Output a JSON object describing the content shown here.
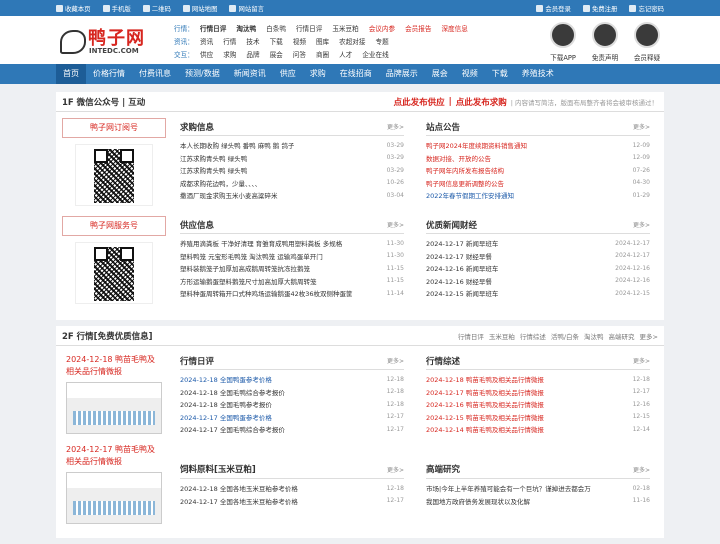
{
  "topbar": {
    "left": [
      "收藏本页",
      "手机版",
      "二维码",
      "网站地图",
      "网站留言"
    ],
    "right": [
      "会员登录",
      "免费注册",
      "忘记密码"
    ]
  },
  "logo": {
    "cn": "鸭子网",
    "en": "INTEDC.COM"
  },
  "hnav": [
    {
      "label": "行情：",
      "items": [
        {
          "t": "行情日评",
          "s": "bold"
        },
        {
          "t": "淘汰鸭",
          "s": "bold"
        },
        {
          "t": "白条鸭",
          "s": ""
        },
        {
          "t": "行情日评",
          "s": ""
        },
        {
          "t": "玉米豆粕",
          "s": ""
        },
        {
          "t": "会议内参",
          "s": "red"
        },
        {
          "t": "会员报告",
          "s": "red"
        },
        {
          "t": "深度信息",
          "s": "red"
        }
      ]
    },
    {
      "label": "资讯：",
      "items": [
        {
          "t": "资讯",
          "s": ""
        },
        {
          "t": "行情",
          "s": ""
        },
        {
          "t": "技术",
          "s": ""
        },
        {
          "t": "下载",
          "s": ""
        },
        {
          "t": "视频",
          "s": ""
        },
        {
          "t": "图库",
          "s": ""
        },
        {
          "t": "农超对接",
          "s": ""
        },
        {
          "t": "专题",
          "s": ""
        }
      ]
    },
    {
      "label": "交互：",
      "items": [
        {
          "t": "供应",
          "s": ""
        },
        {
          "t": "求购",
          "s": ""
        },
        {
          "t": "品牌",
          "s": ""
        },
        {
          "t": "展会",
          "s": ""
        },
        {
          "t": "问答",
          "s": ""
        },
        {
          "t": "商圈",
          "s": ""
        },
        {
          "t": "人才",
          "s": ""
        },
        {
          "t": "企业在线",
          "s": ""
        }
      ]
    }
  ],
  "hicons": [
    "下载APP",
    "免责声明",
    "会员释疑"
  ],
  "mainnav": [
    "首页",
    "价格行情",
    "付费讯息",
    "预测/数据",
    "新闻资讯",
    "供应",
    "求购",
    "在线招商",
    "品牌展示",
    "展会",
    "视频",
    "下载",
    "养殖技术"
  ],
  "f1": {
    "title": "1F 微信公众号 | 互动",
    "link1": "点此发布供应",
    "sep": "|",
    "link2": "点此发布求购",
    "note": "| 内容请写简洁，版面布局整齐者将会被审核通过！",
    "left": [
      "鸭子网订阅号",
      "鸭子网服务号"
    ],
    "cols": [
      {
        "title": "求购信息",
        "more": "更多>",
        "items": [
          [
            "本人长期收购 绿头鸭 番鸭 麻鸭 鹅 鸽子",
            "03-29",
            ""
          ],
          [
            "江苏求购青头鸭 绿头鸭",
            "03-29",
            ""
          ],
          [
            "江苏求购青头鸭 绿头鸭",
            "03-29",
            ""
          ],
          [
            "成都求购花边鸭，少量、、、、",
            "10-26",
            ""
          ],
          [
            "撒酒厂现金求购玉米小麦高粱碎米",
            "03-04",
            ""
          ]
        ]
      },
      {
        "title": "站点公告",
        "more": "更多>",
        "items": [
          [
            "鸭子网2024年度续期资料销售通知",
            "12-09",
            "r"
          ],
          [
            "数据对接、开放的公告",
            "12-09",
            "r"
          ],
          [
            "鸭子网年内所发布报告结构",
            "07-26",
            "r"
          ],
          [
            "鸭子网信息更新调整的公告",
            "04-30",
            "r"
          ],
          [
            "2022年春节假期工作安排通知",
            "01-29",
            "b"
          ]
        ]
      },
      {
        "title": "供应信息",
        "more": "更多>",
        "items": [
          [
            "养殖用滴粪板 干净好清理 育雏育成鸭用塑料粪板 多规格",
            "11-30",
            ""
          ],
          [
            "塑料鸭笼 元宝形毛鸭笼 淘汰鸭笼 运输鸡蛋单开门",
            "11-30",
            ""
          ],
          [
            "塑料装鹅笼子加厚加高成鹅周转笼抗冻拉鹅笼",
            "11-15",
            ""
          ],
          [
            "方形运输鹅蛋塑料鹅笼尺寸加高加厚大鹅周转笼",
            "11-15",
            ""
          ],
          [
            "塑料种蛋周转箱开口式种鸡场运输鹅蛋42枚36枚双侧种蛋筐",
            "11-14",
            ""
          ]
        ]
      },
      {
        "title": "优质新闻财经",
        "more": "更多>",
        "items": [
          [
            "2024-12-17 新闻早班车",
            "2024-12-17",
            ""
          ],
          [
            "2024-12-17 财经早餐",
            "2024-12-17",
            ""
          ],
          [
            "2024-12-16 新闻早班车",
            "2024-12-16",
            ""
          ],
          [
            "2024-12-16 财经早餐",
            "2024-12-16",
            ""
          ],
          [
            "2024-12-15 新闻早班车",
            "2024-12-15",
            ""
          ]
        ]
      }
    ]
  },
  "f2": {
    "title": "2F 行情[免费优质信息]",
    "links": [
      "行情日评",
      "玉米豆粕",
      "行情综述",
      "活鸭/白条",
      "淘汰鸭",
      "高端研究",
      "更多>"
    ],
    "left": [
      "2024-12-18 鸭苗毛鸭及相关品行情微报",
      "2024-12-17 鸭苗毛鸭及相关品行情微报"
    ],
    "cols": [
      {
        "title": "行情日评",
        "more": "更多>",
        "items": [
          [
            "2024-12-18 全国鸭蛋参考价格",
            "12-18",
            "b"
          ],
          [
            "2024-12-18 全国毛鸭综合参考报价",
            "12-18",
            ""
          ],
          [
            "2024-12-18 全国毛鸭参考报价",
            "12-18",
            ""
          ],
          [
            "2024-12-17 全国鸭蛋参考价格",
            "12-17",
            "b"
          ],
          [
            "2024-12-17 全国毛鸭综合参考报价",
            "12-17",
            ""
          ]
        ]
      },
      {
        "title": "行情综述",
        "more": "更多>",
        "items": [
          [
            "2024-12-18 鸭苗毛鸭及相关品行情微报",
            "12-18",
            "r"
          ],
          [
            "2024-12-17 鸭苗毛鸭及相关品行情微报",
            "12-17",
            "r"
          ],
          [
            "2024-12-16 鸭苗毛鸭及相关品行情微报",
            "12-16",
            "r"
          ],
          [
            "2024-12-15 鸭苗毛鸭及相关品行情微报",
            "12-15",
            "r"
          ],
          [
            "2024-12-14 鸭苗毛鸭及相关品行情微报",
            "12-14",
            "r"
          ]
        ]
      },
      {
        "title": "饲料原料[玉米豆粕]",
        "more": "更多>",
        "items": [
          [
            "2024-12-18 全国各地玉米豆粕参考价格",
            "12-18",
            ""
          ],
          [
            "2024-12-17 全国各地玉米豆粕参考价格",
            "12-17",
            ""
          ]
        ]
      },
      {
        "title": "高端研究",
        "more": "更多>",
        "items": [
          [
            "市场|今年上半年养殖可能会有一个巨坑？谨掉进去都会万",
            "02-18",
            ""
          ],
          [
            "我国地方政府债务发展现状以及化解",
            "11-16",
            ""
          ]
        ]
      }
    ]
  }
}
